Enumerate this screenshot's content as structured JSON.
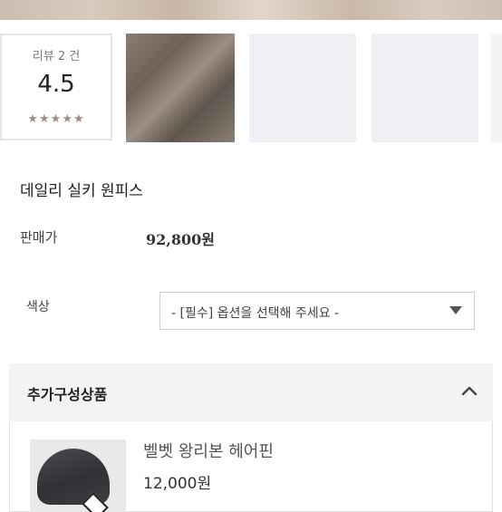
{
  "review": {
    "count_label": "리뷰 2 건",
    "score": "4.5",
    "stars": "★★★★★"
  },
  "product": {
    "title": "데일리 실키 원피스",
    "price_label": "판매가",
    "price_value": "92,800원"
  },
  "option": {
    "color_label": "색상",
    "select_text": "- [필수] 옵션을 선택해 주세요 -"
  },
  "addon": {
    "header_title": "추가구성상품",
    "item_name": "벨벳 왕리본 헤어핀",
    "item_price": "12,000원"
  },
  "icons": {
    "select_arrow": "triangle-down-icon",
    "collapse": "chevron-up-icon"
  }
}
